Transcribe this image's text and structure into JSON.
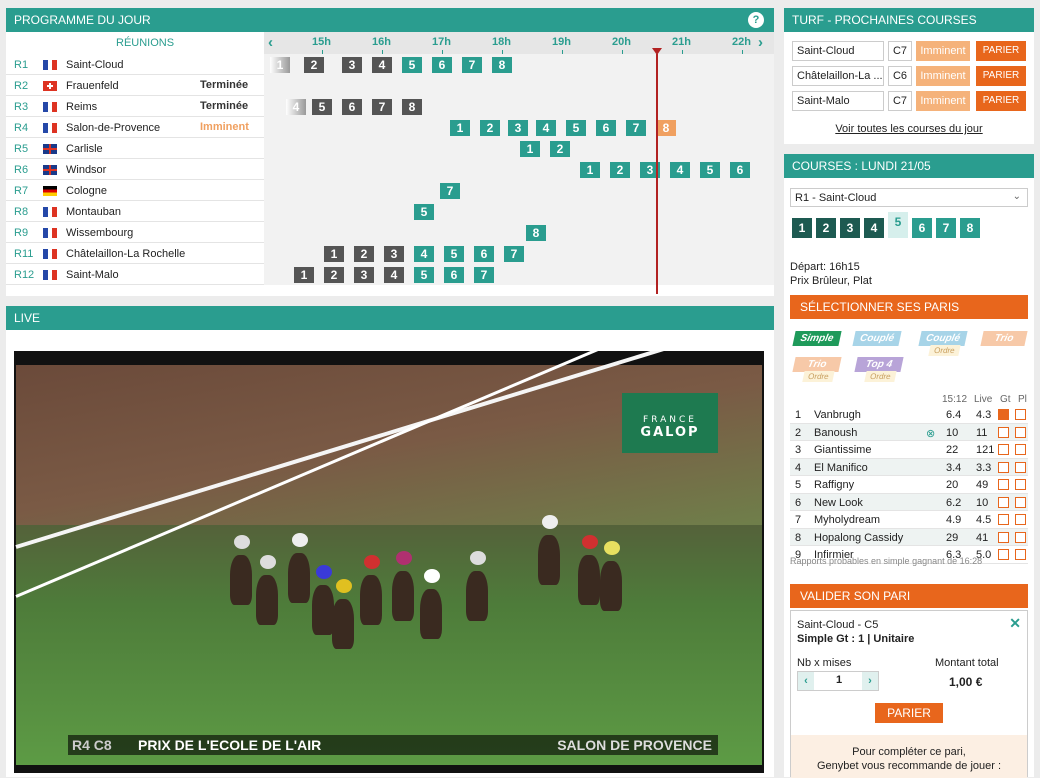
{
  "programme": {
    "title": "PROGRAMME DU JOUR",
    "help": "?",
    "reunions_label": "RÉUNIONS",
    "hours": [
      "15h",
      "16h",
      "17h",
      "18h",
      "19h",
      "20h",
      "21h",
      "22h"
    ],
    "rows": [
      {
        "code": "R1",
        "flag": "FR",
        "name": "Saint-Cloud",
        "status": ""
      },
      {
        "code": "R2",
        "flag": "CH",
        "name": "Frauenfeld",
        "status": "Terminée"
      },
      {
        "code": "R3",
        "flag": "FR",
        "name": "Reims",
        "status": "Terminée"
      },
      {
        "code": "R4",
        "flag": "FR",
        "name": "Salon-de-Provence",
        "status": "Imminent"
      },
      {
        "code": "R5",
        "flag": "GB",
        "name": "Carlisle",
        "status": ""
      },
      {
        "code": "R6",
        "flag": "GB",
        "name": "Windsor",
        "status": ""
      },
      {
        "code": "R7",
        "flag": "DE",
        "name": "Cologne",
        "status": ""
      },
      {
        "code": "R8",
        "flag": "FR",
        "name": "Montauban",
        "status": ""
      },
      {
        "code": "R9",
        "flag": "FR",
        "name": "Wissembourg",
        "status": ""
      },
      {
        "code": "R11",
        "flag": "FR",
        "name": "Châtelaillon-La Rochelle",
        "status": ""
      },
      {
        "code": "R12",
        "flag": "FR",
        "name": "Saint-Malo",
        "status": ""
      }
    ],
    "chips": [
      [
        {
          "n": "1",
          "c": "f"
        },
        {
          "n": "2",
          "c": "g"
        },
        {
          "n": "3",
          "c": "g"
        },
        {
          "n": "4",
          "c": "g"
        },
        {
          "n": "5",
          "c": "t"
        },
        {
          "n": "6",
          "c": "t"
        },
        {
          "n": "7",
          "c": "t"
        },
        {
          "n": "8",
          "c": "t"
        }
      ],
      [],
      [
        {
          "n": "4",
          "c": "f"
        },
        {
          "n": "5",
          "c": "g"
        },
        {
          "n": "6",
          "c": "g"
        },
        {
          "n": "7",
          "c": "g"
        },
        {
          "n": "8",
          "c": "g"
        }
      ],
      [
        {
          "n": "1",
          "c": "t"
        },
        {
          "n": "2",
          "c": "t"
        },
        {
          "n": "3",
          "c": "t"
        },
        {
          "n": "4",
          "c": "t"
        },
        {
          "n": "5",
          "c": "t"
        },
        {
          "n": "6",
          "c": "t"
        },
        {
          "n": "7",
          "c": "t"
        },
        {
          "n": "8",
          "c": "o"
        }
      ],
      [
        {
          "n": "1",
          "c": "t"
        },
        {
          "n": "2",
          "c": "t"
        }
      ],
      [
        {
          "n": "1",
          "c": "t"
        },
        {
          "n": "2",
          "c": "t"
        },
        {
          "n": "3",
          "c": "t"
        },
        {
          "n": "4",
          "c": "t"
        },
        {
          "n": "5",
          "c": "t"
        },
        {
          "n": "6",
          "c": "t"
        }
      ],
      [
        {
          "n": "7",
          "c": "t"
        }
      ],
      [
        {
          "n": "5",
          "c": "t"
        }
      ],
      [
        {
          "n": "8",
          "c": "t"
        }
      ],
      [
        {
          "n": "1",
          "c": "g"
        },
        {
          "n": "2",
          "c": "g"
        },
        {
          "n": "3",
          "c": "g"
        },
        {
          "n": "4",
          "c": "t"
        },
        {
          "n": "5",
          "c": "t"
        },
        {
          "n": "6",
          "c": "t"
        },
        {
          "n": "7",
          "c": "t"
        }
      ],
      [
        {
          "n": "1",
          "c": "g"
        },
        {
          "n": "2",
          "c": "g"
        },
        {
          "n": "3",
          "c": "g"
        },
        {
          "n": "4",
          "c": "g"
        },
        {
          "n": "5",
          "c": "t"
        },
        {
          "n": "6",
          "c": "t"
        },
        {
          "n": "7",
          "c": "t"
        }
      ]
    ]
  },
  "live": {
    "title": "LIVE",
    "logo_line1": "FRANCE",
    "logo_line2": "GALOP",
    "caption_code": "R4 C8",
    "caption_race": "PRIX DE L'ECOLE DE L'AIR",
    "caption_place": "SALON DE PROVENCE"
  },
  "turf": {
    "title": "TURF - PROCHAINES COURSES",
    "items": [
      {
        "name": "Saint-Cloud",
        "course": "C7",
        "status": "Imminent",
        "btn": "PARIER"
      },
      {
        "name": "Châtelaillon-La ...",
        "course": "C6",
        "status": "Imminent",
        "btn": "PARIER"
      },
      {
        "name": "Saint-Malo",
        "course": "C7",
        "status": "Imminent",
        "btn": "PARIER"
      }
    ],
    "voir": "Voir toutes les courses du jour"
  },
  "courses": {
    "title": "COURSES : LUNDI 21/05",
    "select": "R1 - Saint-Cloud",
    "nums": [
      {
        "n": "1",
        "c": "d"
      },
      {
        "n": "2",
        "c": "d"
      },
      {
        "n": "3",
        "c": "d"
      },
      {
        "n": "4",
        "c": "d"
      },
      {
        "n": "5",
        "c": "s"
      },
      {
        "n": "6",
        "c": "t"
      },
      {
        "n": "7",
        "c": "t"
      },
      {
        "n": "8",
        "c": "t"
      }
    ],
    "depart": "Départ: 16h15",
    "prix": "Prix Brûleur, Plat",
    "select_paris": "SÉLECTIONNER SES PARIS",
    "bet_types": [
      {
        "label": "Simple",
        "sub": "",
        "color": "#1e9a5a"
      },
      {
        "label": "Couplé",
        "sub": "",
        "color": "#a7d4e8"
      },
      {
        "label": "Couplé",
        "sub": "Ordre",
        "color": "#a7d4e8"
      },
      {
        "label": "Trio",
        "sub": "",
        "color": "#f7c9a8"
      },
      {
        "label": "Trio",
        "sub": "Ordre",
        "color": "#f7c9a8"
      },
      {
        "label": "Top 4",
        "sub": "Ordre",
        "color": "#b8a4d8"
      }
    ],
    "col_time": "15:12",
    "col_live": "Live",
    "col_gt": "Gt",
    "col_pl": "Pl",
    "runners": [
      {
        "n": "1",
        "name": "Vanbrugh",
        "o1": "6.4",
        "o2": "4.3",
        "gt": true
      },
      {
        "n": "2",
        "name": "Banoush",
        "o1": "10",
        "o2": "11",
        "gt": false
      },
      {
        "n": "3",
        "name": "Giantissime",
        "o1": "22",
        "o2": "121",
        "gt": false
      },
      {
        "n": "4",
        "name": "El Manifico",
        "o1": "3.4",
        "o2": "3.3",
        "gt": false
      },
      {
        "n": "5",
        "name": "Raffigny",
        "o1": "20",
        "o2": "49",
        "gt": false
      },
      {
        "n": "6",
        "name": "New Look",
        "o1": "6.2",
        "o2": "10",
        "gt": false
      },
      {
        "n": "7",
        "name": "Myholydream",
        "o1": "4.9",
        "o2": "4.5",
        "gt": false
      },
      {
        "n": "8",
        "name": "Hopalong Cassidy",
        "o1": "29",
        "o2": "41",
        "gt": false
      },
      {
        "n": "9",
        "name": "Infirmier",
        "o1": "6.3",
        "o2": "5.0",
        "gt": false
      }
    ],
    "note": "Rapports probables en simple gagnant de 16:28",
    "valider": "VALIDER SON PARI",
    "bet_line1": "Saint-Cloud - C5",
    "bet_line2": "Simple Gt : 1 | Unitaire",
    "nb_mises": "Nb x mises",
    "montant": "Montant total",
    "qty": "1",
    "total": "1,00 €",
    "parier": "PARIER",
    "recom1": "Pour compléter ce pari,",
    "recom2": "Genybet vous recommande de jouer :"
  }
}
